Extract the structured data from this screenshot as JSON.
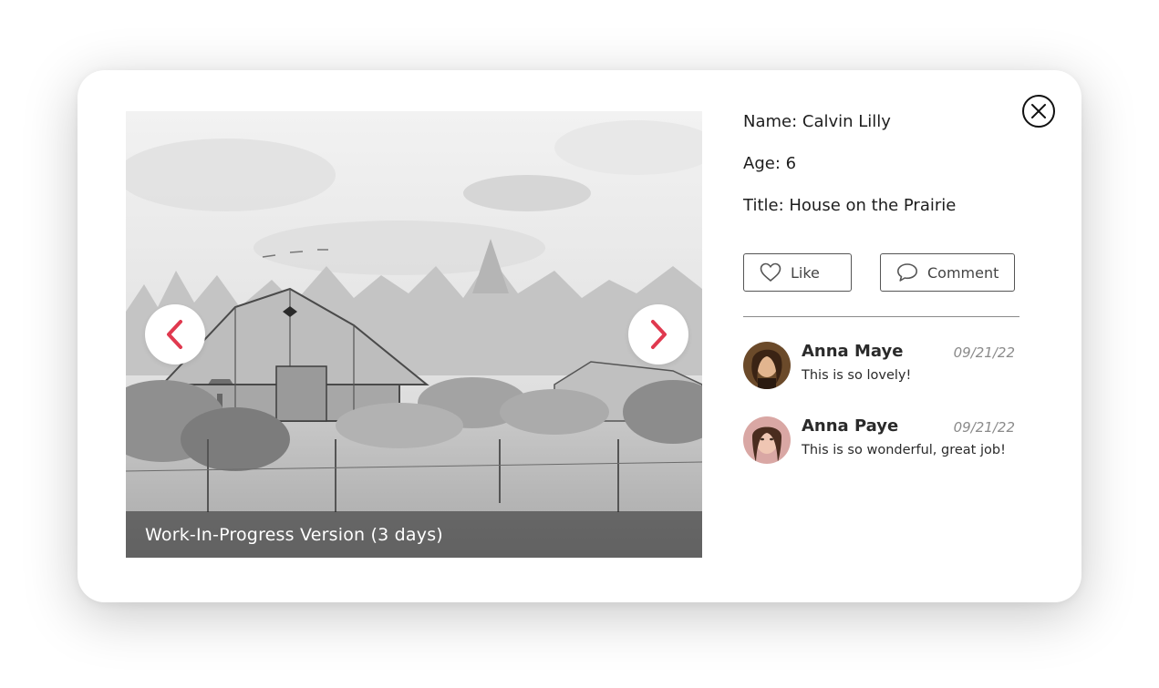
{
  "artwork": {
    "caption": "Work-In-Progress Version (3 days)",
    "prev_icon": "chevron-left-icon",
    "next_icon": "chevron-right-icon"
  },
  "details": {
    "name": "Name: Calvin Lilly",
    "age": "Age: 6",
    "title": "Title: House on the Prairie"
  },
  "actions": {
    "like_label": "Like",
    "like_icon": "heart-icon",
    "comment_label": "Comment",
    "comment_icon": "speech-bubble-icon"
  },
  "close_icon": "close-icon",
  "comments": [
    {
      "author": "Anna Maye",
      "date": "09/21/22",
      "text": "This is so lovely!"
    },
    {
      "author": "Anna Paye",
      "date": "09/21/22",
      "text": "This is so wonderful, great job!"
    }
  ],
  "colors": {
    "accent": "#e0394f",
    "caption_bg": "#3a3a3a",
    "border": "#555555",
    "muted": "#8a8a8a"
  }
}
